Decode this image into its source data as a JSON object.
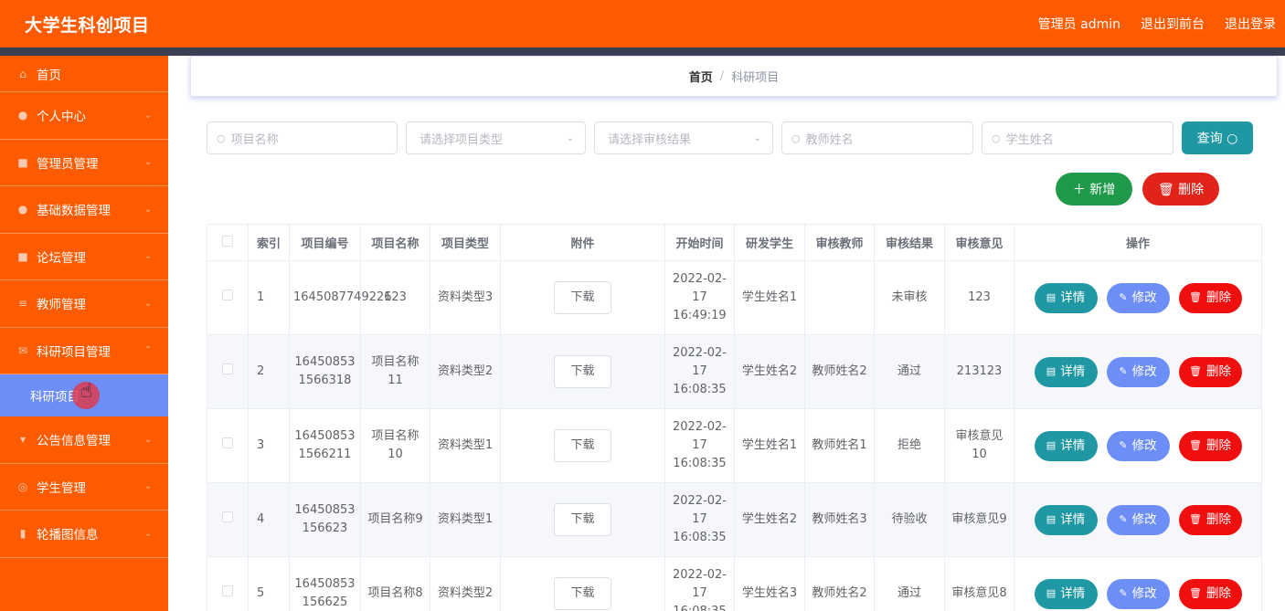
{
  "app": {
    "title": "大学生科创项目",
    "user_label": "管理员 admin",
    "front_label": "退出到前台",
    "logout_label": "退出登录"
  },
  "sidebar": {
    "items": [
      {
        "label": "首页",
        "icon": "home-icon",
        "glyph": "⌂"
      },
      {
        "label": "个人中心",
        "icon": "user-icon",
        "glyph": "●"
      },
      {
        "label": "管理员管理",
        "icon": "id-card-icon",
        "glyph": "■"
      },
      {
        "label": "基础数据管理",
        "icon": "user-icon",
        "glyph": "●"
      },
      {
        "label": "论坛管理",
        "icon": "briefcase-icon",
        "glyph": "■"
      },
      {
        "label": "教师管理",
        "icon": "sliders-icon",
        "glyph": "≡"
      },
      {
        "label": "科研项目管理",
        "icon": "mail-icon",
        "glyph": "✉"
      }
    ],
    "active_sub": "科研项目",
    "items_after": [
      {
        "label": "公告信息管理",
        "icon": "notice-icon",
        "glyph": "▾"
      },
      {
        "label": "学生管理",
        "icon": "clock-icon",
        "glyph": "◎"
      },
      {
        "label": "轮播图信息",
        "icon": "chart-icon",
        "glyph": "▮"
      }
    ],
    "chevron_down": "⌄",
    "chevron_up": "⌃"
  },
  "breadcrumb": {
    "home": "首页",
    "sep": "/",
    "current": "科研项目"
  },
  "filters": {
    "project_name_placeholder": "项目名称",
    "project_type_placeholder": "请选择项目类型",
    "review_result_placeholder": "请选择审核结果",
    "teacher_name_placeholder": "教师姓名",
    "student_name_placeholder": "学生姓名",
    "search_glyph": "○",
    "arrow_glyph": "⌄"
  },
  "buttons": {
    "query": "查询 ○",
    "add": "＋ 新增",
    "delete": "🗑 删除"
  },
  "table": {
    "headers": [
      "",
      "索引",
      "项目编号",
      "项目名称",
      "项目类型",
      "附件",
      "开始时间",
      "研发学生",
      "审核教师",
      "审核结果",
      "审核意见",
      "操作"
    ],
    "download_label": "下载",
    "op_detail": "详情",
    "op_edit": "修改",
    "op_delete": "删除",
    "rows": [
      {
        "index": "1",
        "code": "1645087749226",
        "name": "123",
        "type": "资料类型3",
        "start": "2022-02-17 16:49:19",
        "student": "学生姓名1",
        "teacher": "",
        "result": "未审核",
        "opinion": "123"
      },
      {
        "index": "2",
        "code": "16450853 1566318",
        "name": "项目名称11",
        "type": "资料类型2",
        "start": "2022-02-17 16:08:35",
        "student": "学生姓名2",
        "teacher": "教师姓名2",
        "result": "通过",
        "opinion": "213123"
      },
      {
        "index": "3",
        "code": "16450853 1566211",
        "name": "项目名称10",
        "type": "资料类型1",
        "start": "2022-02-17 16:08:35",
        "student": "学生姓名1",
        "teacher": "教师姓名1",
        "result": "拒绝",
        "opinion": "审核意见10"
      },
      {
        "index": "4",
        "code": "16450853 156623",
        "name": "项目名称9",
        "type": "资料类型1",
        "start": "2022-02-17 16:08:35",
        "student": "学生姓名2",
        "teacher": "教师姓名3",
        "result": "待验收",
        "opinion": "审核意见9"
      },
      {
        "index": "5",
        "code": "16450853 156625",
        "name": "项目名称8",
        "type": "资料类型2",
        "start": "2022-02-17 16:08:35",
        "student": "学生姓名3",
        "teacher": "教师姓名2",
        "result": "通过",
        "opinion": "审核意见8"
      }
    ]
  },
  "colors": {
    "brand": "#fe5a00",
    "active_sub": "#6e8ef7",
    "teal": "#1f98a4",
    "green": "#1f9a4a",
    "red": "#e2231a"
  }
}
